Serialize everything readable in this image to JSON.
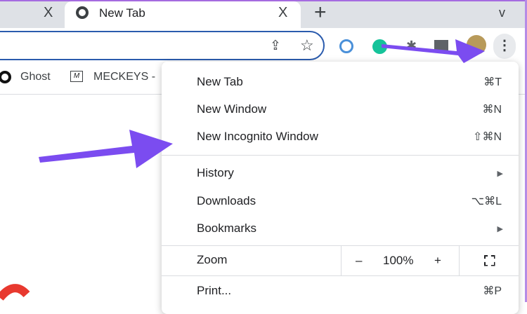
{
  "tabs": [
    {
      "label": "",
      "close": "X"
    },
    {
      "label": "New Tab",
      "close": "X",
      "active": true
    }
  ],
  "new_tab_button": "+",
  "tab_search": "v",
  "bookmarks": [
    {
      "label": "Ghost"
    },
    {
      "label": "MECKEYS -"
    }
  ],
  "menu": {
    "items": [
      {
        "label": "New Tab",
        "shortcut": "⌘T"
      },
      {
        "label": "New Window",
        "shortcut": "⌘N"
      },
      {
        "label": "New Incognito Window",
        "shortcut": "⇧⌘N"
      },
      {
        "label": "History",
        "submenu": "▶"
      },
      {
        "label": "Downloads",
        "shortcut": "⌥⌘L"
      },
      {
        "label": "Bookmarks",
        "submenu": "▶"
      }
    ],
    "zoom": {
      "label": "Zoom",
      "minus": "–",
      "value": "100%",
      "plus": "+"
    },
    "print": {
      "label": "Print...",
      "shortcut": "⌘P"
    }
  },
  "colors": {
    "arrow": "#7b4cf0",
    "omnibox_border": "#2a5bad",
    "tabstrip": "#dee1e6"
  }
}
